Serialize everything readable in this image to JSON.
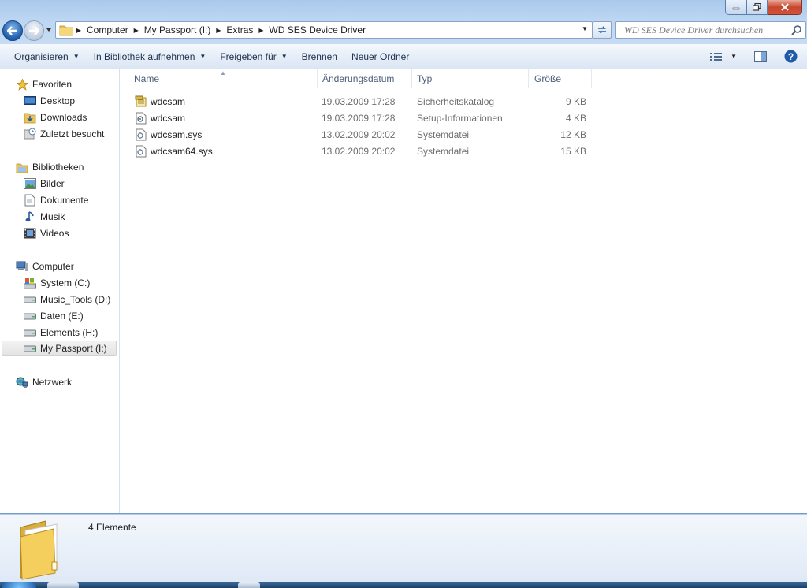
{
  "window": {
    "controls": [
      "minimize-icon",
      "maximize-icon",
      "close-icon"
    ]
  },
  "address": {
    "crumbs": [
      "Computer",
      "My Passport (I:)",
      "Extras",
      "WD SES Device Driver"
    ]
  },
  "search": {
    "placeholder": "WD SES Device Driver durchsuchen"
  },
  "toolbar": {
    "organize": "Organisieren",
    "include_library": "In Bibliothek aufnehmen",
    "share": "Freigeben für",
    "burn": "Brennen",
    "new_folder": "Neuer Ordner"
  },
  "sidebar": {
    "favorites": {
      "label": "Favoriten",
      "items": [
        "Desktop",
        "Downloads",
        "Zuletzt besucht"
      ]
    },
    "libraries": {
      "label": "Bibliotheken",
      "items": [
        "Bilder",
        "Dokumente",
        "Musik",
        "Videos"
      ]
    },
    "computer": {
      "label": "Computer",
      "items": [
        "System (C:)",
        "Music_Tools (D:)",
        "Daten (E:)",
        "Elements (H:)",
        "My Passport (I:)"
      ]
    },
    "network": {
      "label": "Netzwerk"
    }
  },
  "columns": {
    "name": "Name",
    "date": "Änderungsdatum",
    "type": "Typ",
    "size": "Größe"
  },
  "files": [
    {
      "name": "wdcsam",
      "date": "19.03.2009 17:28",
      "type": "Sicherheitskatalog",
      "size": "9 KB",
      "icon": "catalog-icon"
    },
    {
      "name": "wdcsam",
      "date": "19.03.2009 17:28",
      "type": "Setup-Informationen",
      "size": "4 KB",
      "icon": "setup-info-icon"
    },
    {
      "name": "wdcsam.sys",
      "date": "13.02.2009 20:02",
      "type": "Systemdatei",
      "size": "12 KB",
      "icon": "system-file-icon"
    },
    {
      "name": "wdcsam64.sys",
      "date": "13.02.2009 20:02",
      "type": "Systemdatei",
      "size": "15 KB",
      "icon": "system-file-icon"
    }
  ],
  "details": {
    "count": "4 Elemente"
  },
  "colors": {
    "accent": "#1f5aa8",
    "selection": "#e3e3e3"
  }
}
